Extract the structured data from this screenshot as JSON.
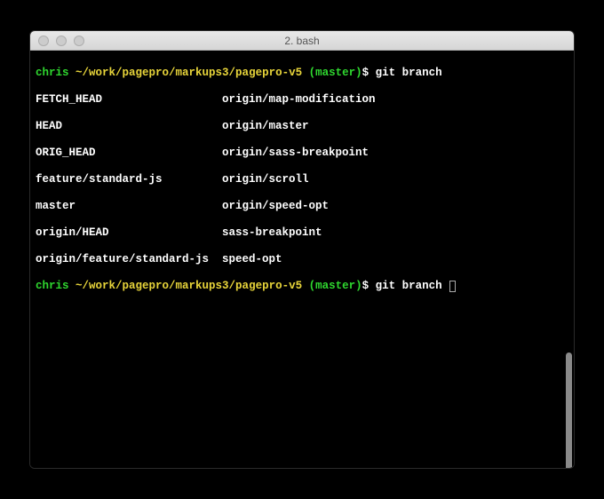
{
  "window": {
    "title": "2. bash"
  },
  "prompt": {
    "user": "chris",
    "path": "~/work/pagepro/markups3/pagepro-v5",
    "branch": "(master)",
    "symbol": "$"
  },
  "lines": [
    {
      "command": "git branch"
    }
  ],
  "branches": {
    "col1": [
      "FETCH_HEAD",
      "HEAD",
      "ORIG_HEAD",
      "feature/standard-js",
      "master",
      "origin/HEAD",
      "origin/feature/standard-js"
    ],
    "col2": [
      "origin/map-modification",
      "origin/master",
      "origin/sass-breakpoint",
      "origin/scroll",
      "origin/speed-opt",
      "sass-breakpoint",
      "speed-opt"
    ]
  },
  "current": {
    "command": "git branch "
  }
}
